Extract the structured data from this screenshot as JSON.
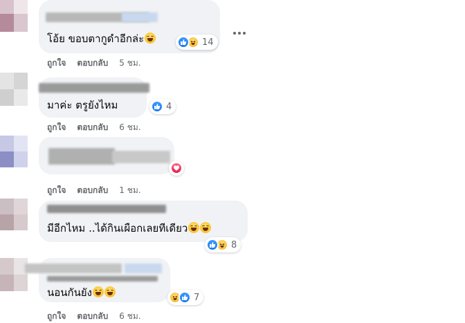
{
  "comments": [
    {
      "text": "โอ้ย ขอบตากูดำอีกล่ะ",
      "reaction_count": "14",
      "reactions": [
        "like-icon",
        "haha-icon"
      ],
      "like_label": "ถูกใจ",
      "reply_label": "ตอบกลับ",
      "time": "5 ชม."
    },
    {
      "text": "มาค่ะ ตรูยังไหม",
      "reaction_count": "4",
      "reactions": [
        "like-icon"
      ],
      "like_label": "ถูกใจ",
      "reply_label": "ตอบกลับ",
      "time": "6 ชม."
    },
    {
      "text": "",
      "reaction_count": "",
      "reactions": [
        "love-icon"
      ],
      "like_label": "ถูกใจ",
      "reply_label": "ตอบกลับ",
      "time": "1 ชม."
    },
    {
      "text": "มีอีกไหม ..ได้กินเผือกเลยทีเดียว",
      "reaction_count": "8",
      "reactions": [
        "like-icon",
        "haha-icon"
      ],
      "like_label": "ถูกใจ",
      "reply_label": "ตอบกลับ",
      "time": "5 ชม."
    },
    {
      "text": "นอนกันยัง",
      "reaction_count": "7",
      "reactions": [
        "haha-icon",
        "like-icon"
      ],
      "like_label": "ถูกใจ",
      "reply_label": "ตอบกลับ",
      "time": "6 ชม."
    }
  ],
  "colors": {
    "bubble": "#f0f2f5",
    "meta_text": "#65676b",
    "like_blue": "#1877f2",
    "love_red": "#e61e4d",
    "haha_yellow": "#f7b125"
  }
}
